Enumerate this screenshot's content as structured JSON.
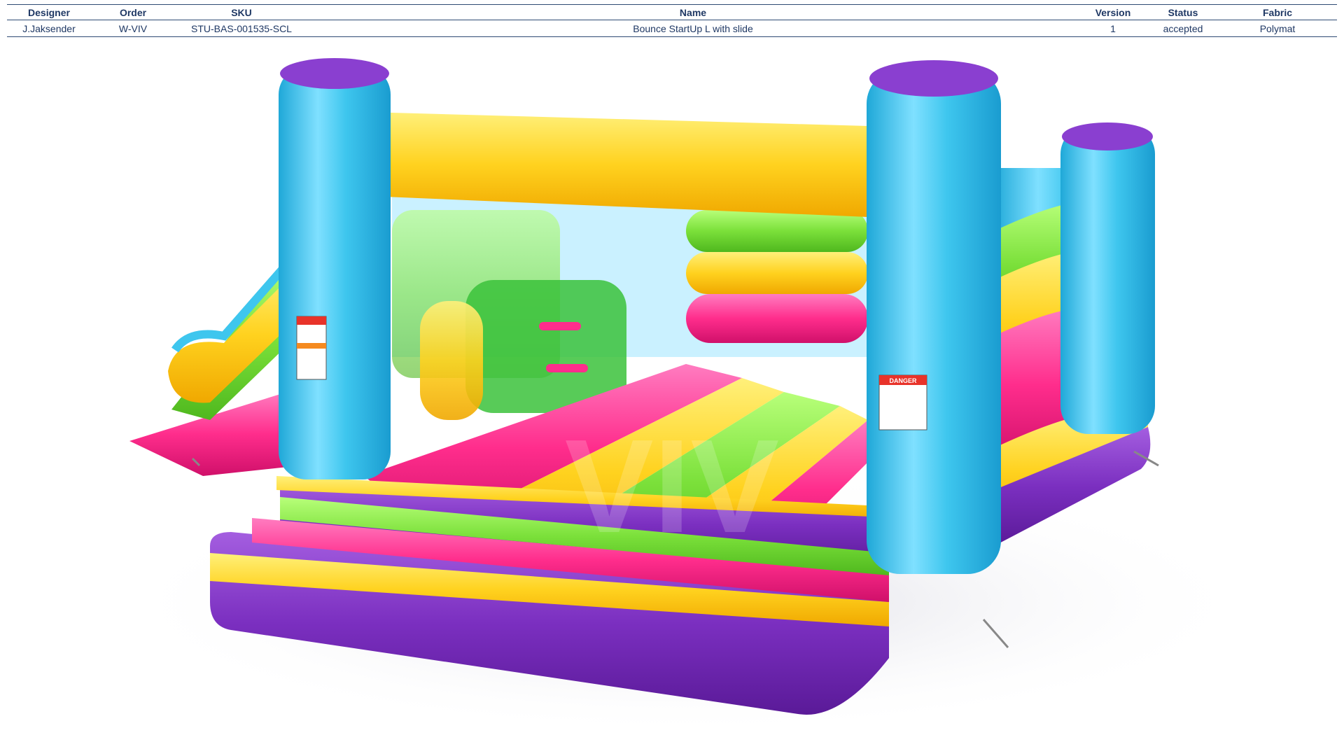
{
  "sheet": {
    "columns": {
      "designer": "Designer",
      "order": "Order",
      "sku": "SKU",
      "name": "Name",
      "version": "Version",
      "status": "Status",
      "fabric": "Fabric"
    },
    "row": {
      "designer": "J.Jaksender",
      "order": "W-VIV",
      "sku": "STU-BAS-001535-SCL",
      "name": "Bounce StartUp L with slide",
      "version": "1",
      "status": "accepted",
      "fabric": "Polymat"
    }
  },
  "render": {
    "watermark": "VIV",
    "warning_label": "DANGER",
    "colors": {
      "blue": "#3ec6ee",
      "yellow": "#ffd21f",
      "green": "#7be03a",
      "pink": "#ff2d8c",
      "purple": "#7b2fc0",
      "header_text": "#1f3864"
    }
  }
}
